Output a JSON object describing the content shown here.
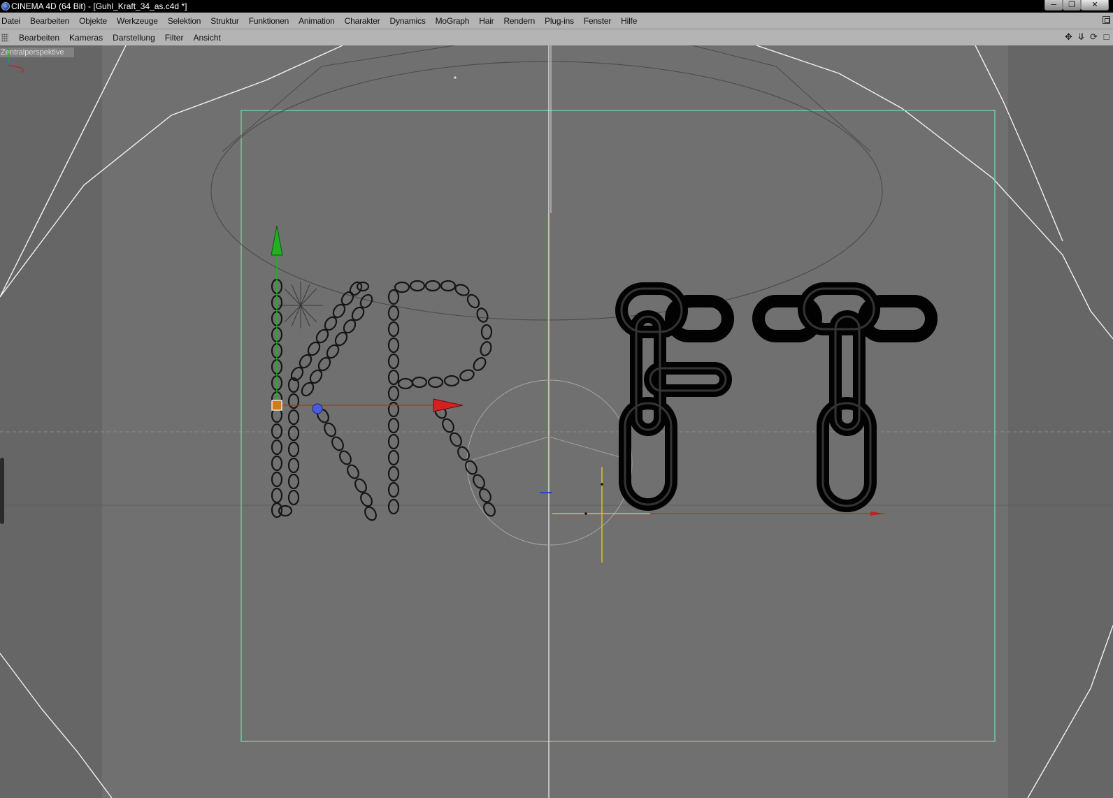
{
  "window": {
    "title": "CINEMA 4D (64 Bit) - [Guhl_Kraft_34_as.c4d *]",
    "buttons": [
      "minimize",
      "maximize",
      "close"
    ]
  },
  "menubar": {
    "items": [
      "Datei",
      "Bearbeiten",
      "Objekte",
      "Werkzeuge",
      "Selektion",
      "Struktur",
      "Funktionen",
      "Animation",
      "Charakter",
      "Dynamics",
      "MoGraph",
      "Hair",
      "Rendern",
      "Plug-ins",
      "Fenster",
      "Hilfe"
    ]
  },
  "viewport_menu": {
    "items": [
      "Bearbeiten",
      "Kameras",
      "Darstellung",
      "Filter",
      "Ansicht"
    ],
    "nav_icons": [
      "move-view-icon",
      "zoom-view-icon",
      "rotate-view-icon",
      "maximize-view-icon"
    ]
  },
  "viewport": {
    "label": "Zentralperspektive",
    "background_color": "#6e6e6e",
    "safe_frame_color": "#74d6a8",
    "axes": [
      "Y",
      "Z",
      "X"
    ]
  },
  "scene": {
    "chain_letters_wireframe": [
      "K",
      "R"
    ],
    "chain_letters_solid": [
      "F",
      "T"
    ],
    "object_colors": {
      "y_axis": "#22b022",
      "x_axis": "#d42020",
      "z_axis": "#4a5bdc",
      "selection": "#f0d000"
    }
  }
}
